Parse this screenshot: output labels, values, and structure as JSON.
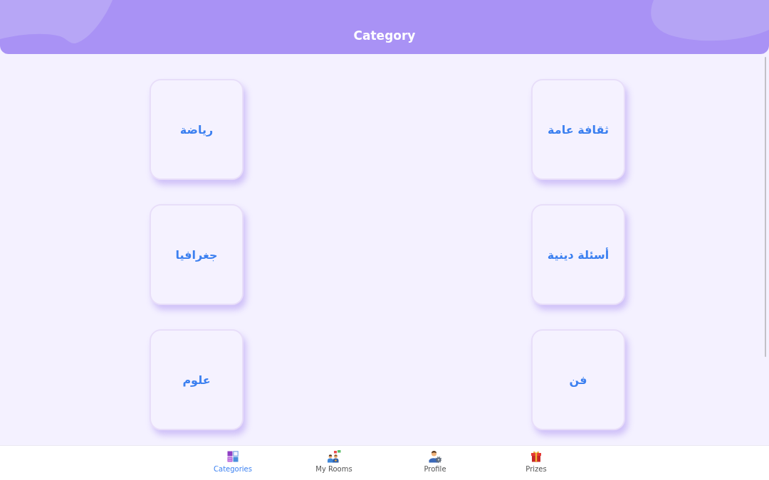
{
  "header": {
    "title": "Category"
  },
  "categories": [
    {
      "label": "ثقافة عامة"
    },
    {
      "label": "رياضة"
    },
    {
      "label": "أسئلة دينية"
    },
    {
      "label": "جغرافيا"
    },
    {
      "label": "فن"
    },
    {
      "label": "علوم"
    }
  ],
  "bottom_nav": [
    {
      "label": "Prizes",
      "kind": "gift",
      "selected": false
    },
    {
      "label": "Profile",
      "kind": "profile",
      "selected": false
    },
    {
      "label": "My Rooms",
      "kind": "rooms",
      "selected": false
    },
    {
      "label": "Categories",
      "kind": "grid",
      "selected": true
    }
  ]
}
